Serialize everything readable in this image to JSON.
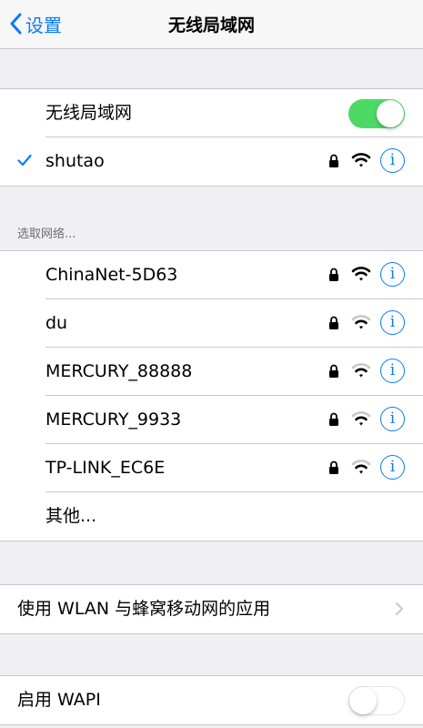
{
  "nav": {
    "back_label": "设置",
    "title": "无线局域网"
  },
  "wlan": {
    "toggle_label": "无线局域网",
    "toggle_on": true
  },
  "connected": {
    "name": "shutao"
  },
  "section_header": "选取网络...",
  "networks": [
    {
      "name": "ChinaNet-5D63",
      "locked": true,
      "signal": 3
    },
    {
      "name": "du",
      "locked": true,
      "signal": 2
    },
    {
      "name": "MERCURY_88888",
      "locked": true,
      "signal": 2
    },
    {
      "name": "MERCURY_9933",
      "locked": true,
      "signal": 2
    },
    {
      "name": "TP-LINK_EC6E",
      "locked": true,
      "signal": 2
    }
  ],
  "other_label": "其他...",
  "apps_row": {
    "label": "使用 WLAN 与蜂窝移动网的应用"
  },
  "wapi": {
    "label": "启用 WAPI",
    "toggle_on": false
  },
  "colors": {
    "accent": "#0a7aff",
    "toggle_on": "#4cd964",
    "background": "#efeff4"
  }
}
